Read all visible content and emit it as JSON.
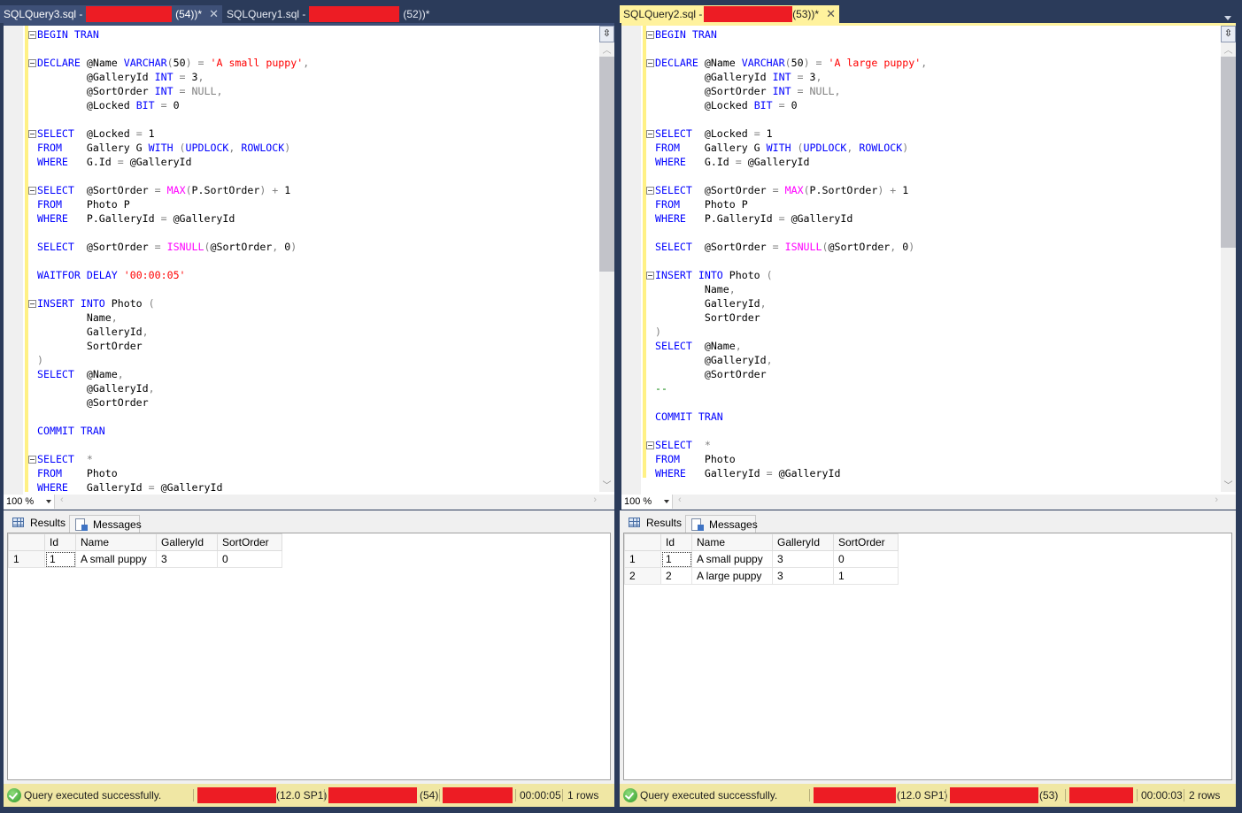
{
  "left": {
    "tabs": [
      {
        "title": "SQLQuery3.sql -",
        "suffix": "(54))*",
        "state": "active",
        "close": "✕"
      },
      {
        "title": "SQLQuery1.sql -",
        "suffix": "(52))*",
        "state": "inactive"
      }
    ],
    "code": [
      [
        {
          "t": "BEGIN TRAN",
          "c": "kw"
        }
      ],
      [],
      [
        {
          "t": "DECLARE",
          "c": "kw"
        },
        {
          "t": " @Name "
        },
        {
          "t": "VARCHAR",
          "c": "kw"
        },
        {
          "t": "(",
          "c": "gray"
        },
        {
          "t": "50"
        },
        {
          "t": ")",
          "c": "gray"
        },
        {
          "t": " = ",
          "c": "gray"
        },
        {
          "t": "'A small puppy'",
          "c": "str"
        },
        {
          "t": ",",
          "c": "gray"
        }
      ],
      [
        {
          "t": "        @GalleryId "
        },
        {
          "t": "INT",
          "c": "kw"
        },
        {
          "t": " = ",
          "c": "gray"
        },
        {
          "t": "3"
        },
        {
          "t": ",",
          "c": "gray"
        }
      ],
      [
        {
          "t": "        @SortOrder "
        },
        {
          "t": "INT",
          "c": "kw"
        },
        {
          "t": " = ",
          "c": "gray"
        },
        {
          "t": "NULL",
          "c": "gray"
        },
        {
          "t": ",",
          "c": "gray"
        }
      ],
      [
        {
          "t": "        @Locked "
        },
        {
          "t": "BIT",
          "c": "kw"
        },
        {
          "t": " = ",
          "c": "gray"
        },
        {
          "t": "0"
        }
      ],
      [],
      [
        {
          "t": "SELECT",
          "c": "kw"
        },
        {
          "t": "  @Locked "
        },
        {
          "t": "=",
          "c": "gray"
        },
        {
          "t": " 1"
        }
      ],
      [
        {
          "t": "FROM",
          "c": "kw"
        },
        {
          "t": "    Gallery G "
        },
        {
          "t": "WITH",
          "c": "kw"
        },
        {
          "t": " (",
          "c": "gray"
        },
        {
          "t": "UPDLOCK",
          "c": "kw"
        },
        {
          "t": ", ",
          "c": "gray"
        },
        {
          "t": "ROWLOCK",
          "c": "kw"
        },
        {
          "t": ")",
          "c": "gray"
        }
      ],
      [
        {
          "t": "WHERE",
          "c": "kw"
        },
        {
          "t": "   G.Id "
        },
        {
          "t": "=",
          "c": "gray"
        },
        {
          "t": " @GalleryId"
        }
      ],
      [],
      [
        {
          "t": "SELECT",
          "c": "kw"
        },
        {
          "t": "  @SortOrder "
        },
        {
          "t": "=",
          "c": "gray"
        },
        {
          "t": " "
        },
        {
          "t": "MAX",
          "c": "fn"
        },
        {
          "t": "(",
          "c": "gray"
        },
        {
          "t": "P.SortOrder"
        },
        {
          "t": ")",
          "c": "gray"
        },
        {
          "t": " + ",
          "c": "gray"
        },
        {
          "t": "1"
        }
      ],
      [
        {
          "t": "FROM",
          "c": "kw"
        },
        {
          "t": "    Photo P"
        }
      ],
      [
        {
          "t": "WHERE",
          "c": "kw"
        },
        {
          "t": "   P.GalleryId "
        },
        {
          "t": "=",
          "c": "gray"
        },
        {
          "t": " @GalleryId"
        }
      ],
      [],
      [
        {
          "t": "SELECT",
          "c": "kw"
        },
        {
          "t": "  @SortOrder "
        },
        {
          "t": "=",
          "c": "gray"
        },
        {
          "t": " "
        },
        {
          "t": "ISNULL",
          "c": "fn"
        },
        {
          "t": "(",
          "c": "gray"
        },
        {
          "t": "@SortOrder"
        },
        {
          "t": ", ",
          "c": "gray"
        },
        {
          "t": "0"
        },
        {
          "t": ")",
          "c": "gray"
        }
      ],
      [],
      [
        {
          "t": "WAITFOR DELAY ",
          "c": "kw"
        },
        {
          "t": "'00:00:05'",
          "c": "str"
        }
      ],
      [],
      [
        {
          "t": "INSERT INTO",
          "c": "kw"
        },
        {
          "t": " Photo "
        },
        {
          "t": "(",
          "c": "gray"
        }
      ],
      [
        {
          "t": "        Name"
        },
        {
          "t": ",",
          "c": "gray"
        }
      ],
      [
        {
          "t": "        GalleryId"
        },
        {
          "t": ",",
          "c": "gray"
        }
      ],
      [
        {
          "t": "        SortOrder"
        }
      ],
      [
        {
          "t": ")",
          "c": "gray"
        }
      ],
      [
        {
          "t": "SELECT",
          "c": "kw"
        },
        {
          "t": "  @Name"
        },
        {
          "t": ",",
          "c": "gray"
        }
      ],
      [
        {
          "t": "        @GalleryId"
        },
        {
          "t": ",",
          "c": "gray"
        }
      ],
      [
        {
          "t": "        @SortOrder"
        }
      ],
      [],
      [
        {
          "t": "COMMIT TRAN",
          "c": "kw"
        }
      ],
      [],
      [
        {
          "t": "SELECT",
          "c": "kw"
        },
        {
          "t": "  "
        },
        {
          "t": "*",
          "c": "gray"
        }
      ],
      [
        {
          "t": "FROM",
          "c": "kw"
        },
        {
          "t": "    Photo"
        }
      ],
      [
        {
          "t": "WHERE",
          "c": "kw"
        },
        {
          "t": "   GalleryId "
        },
        {
          "t": "=",
          "c": "gray"
        },
        {
          "t": " @GalleryId"
        }
      ]
    ],
    "folds": [
      0,
      2,
      7,
      11,
      19,
      30
    ],
    "zoom": "100 %",
    "results_tab": "Results",
    "messages_tab": "Messages",
    "columns": [
      "",
      "Id",
      "Name",
      "GalleryId",
      "SortOrder"
    ],
    "rows": [
      [
        "1",
        "1",
        "A small puppy",
        "3",
        "0"
      ]
    ],
    "status": {
      "message": "Query executed successfully.",
      "version": "(12.0 SP1)",
      "spid": "(54)",
      "elapsed": "00:00:05",
      "rows": "1 rows"
    }
  },
  "right": {
    "tabs": [
      {
        "title": "SQLQuery2.sql -",
        "suffix": "(53))*",
        "state": "active",
        "close": "✕"
      }
    ],
    "code": [
      [
        {
          "t": "BEGIN TRAN",
          "c": "kw"
        }
      ],
      [],
      [
        {
          "t": "DECLARE",
          "c": "kw"
        },
        {
          "t": " @Name "
        },
        {
          "t": "VARCHAR",
          "c": "kw"
        },
        {
          "t": "(",
          "c": "gray"
        },
        {
          "t": "50"
        },
        {
          "t": ")",
          "c": "gray"
        },
        {
          "t": " = ",
          "c": "gray"
        },
        {
          "t": "'A large puppy'",
          "c": "str"
        },
        {
          "t": ",",
          "c": "gray"
        }
      ],
      [
        {
          "t": "        @GalleryId "
        },
        {
          "t": "INT",
          "c": "kw"
        },
        {
          "t": " = ",
          "c": "gray"
        },
        {
          "t": "3"
        },
        {
          "t": ",",
          "c": "gray"
        }
      ],
      [
        {
          "t": "        @SortOrder "
        },
        {
          "t": "INT",
          "c": "kw"
        },
        {
          "t": " = ",
          "c": "gray"
        },
        {
          "t": "NULL",
          "c": "gray"
        },
        {
          "t": ",",
          "c": "gray"
        }
      ],
      [
        {
          "t": "        @Locked "
        },
        {
          "t": "BIT",
          "c": "kw"
        },
        {
          "t": " = ",
          "c": "gray"
        },
        {
          "t": "0"
        }
      ],
      [],
      [
        {
          "t": "SELECT",
          "c": "kw"
        },
        {
          "t": "  @Locked "
        },
        {
          "t": "=",
          "c": "gray"
        },
        {
          "t": " 1"
        }
      ],
      [
        {
          "t": "FROM",
          "c": "kw"
        },
        {
          "t": "    Gallery G "
        },
        {
          "t": "WITH",
          "c": "kw"
        },
        {
          "t": " (",
          "c": "gray"
        },
        {
          "t": "UPDLOCK",
          "c": "kw"
        },
        {
          "t": ", ",
          "c": "gray"
        },
        {
          "t": "ROWLOCK",
          "c": "kw"
        },
        {
          "t": ")",
          "c": "gray"
        }
      ],
      [
        {
          "t": "WHERE",
          "c": "kw"
        },
        {
          "t": "   G.Id "
        },
        {
          "t": "=",
          "c": "gray"
        },
        {
          "t": " @GalleryId"
        }
      ],
      [],
      [
        {
          "t": "SELECT",
          "c": "kw"
        },
        {
          "t": "  @SortOrder "
        },
        {
          "t": "=",
          "c": "gray"
        },
        {
          "t": " "
        },
        {
          "t": "MAX",
          "c": "fn"
        },
        {
          "t": "(",
          "c": "gray"
        },
        {
          "t": "P.SortOrder"
        },
        {
          "t": ")",
          "c": "gray"
        },
        {
          "t": " + ",
          "c": "gray"
        },
        {
          "t": "1"
        }
      ],
      [
        {
          "t": "FROM",
          "c": "kw"
        },
        {
          "t": "    Photo P"
        }
      ],
      [
        {
          "t": "WHERE",
          "c": "kw"
        },
        {
          "t": "   P.GalleryId "
        },
        {
          "t": "=",
          "c": "gray"
        },
        {
          "t": " @GalleryId"
        }
      ],
      [],
      [
        {
          "t": "SELECT",
          "c": "kw"
        },
        {
          "t": "  @SortOrder "
        },
        {
          "t": "=",
          "c": "gray"
        },
        {
          "t": " "
        },
        {
          "t": "ISNULL",
          "c": "fn"
        },
        {
          "t": "(",
          "c": "gray"
        },
        {
          "t": "@SortOrder"
        },
        {
          "t": ", ",
          "c": "gray"
        },
        {
          "t": "0"
        },
        {
          "t": ")",
          "c": "gray"
        }
      ],
      [],
      [
        {
          "t": "INSERT INTO",
          "c": "kw"
        },
        {
          "t": " Photo "
        },
        {
          "t": "(",
          "c": "gray"
        }
      ],
      [
        {
          "t": "        Name"
        },
        {
          "t": ",",
          "c": "gray"
        }
      ],
      [
        {
          "t": "        GalleryId"
        },
        {
          "t": ",",
          "c": "gray"
        }
      ],
      [
        {
          "t": "        SortOrder"
        }
      ],
      [
        {
          "t": ")",
          "c": "gray"
        }
      ],
      [
        {
          "t": "SELECT",
          "c": "kw"
        },
        {
          "t": "  @Name"
        },
        {
          "t": ",",
          "c": "gray"
        }
      ],
      [
        {
          "t": "        @GalleryId"
        },
        {
          "t": ",",
          "c": "gray"
        }
      ],
      [
        {
          "t": "        @SortOrder"
        }
      ],
      [
        {
          "t": "--",
          "c": "cm"
        }
      ],
      [],
      [
        {
          "t": "COMMIT TRAN",
          "c": "kw"
        }
      ],
      [],
      [
        {
          "t": "SELECT",
          "c": "kw"
        },
        {
          "t": "  "
        },
        {
          "t": "*",
          "c": "gray"
        }
      ],
      [
        {
          "t": "FROM",
          "c": "kw"
        },
        {
          "t": "    Photo"
        }
      ],
      [
        {
          "t": "WHERE",
          "c": "kw"
        },
        {
          "t": "   GalleryId "
        },
        {
          "t": "=",
          "c": "gray"
        },
        {
          "t": " @GalleryId"
        }
      ]
    ],
    "folds": [
      0,
      2,
      7,
      11,
      17,
      29
    ],
    "zoom": "100 %",
    "results_tab": "Results",
    "messages_tab": "Messages",
    "columns": [
      "",
      "Id",
      "Name",
      "GalleryId",
      "SortOrder"
    ],
    "rows": [
      [
        "1",
        "1",
        "A small puppy",
        "3",
        "0"
      ],
      [
        "2",
        "2",
        "A large puppy",
        "3",
        "1"
      ]
    ],
    "status": {
      "message": "Query executed successfully.",
      "version": "(12.0 SP1)",
      "spid": "(53)",
      "elapsed": "00:00:03",
      "rows": "2 rows"
    }
  }
}
